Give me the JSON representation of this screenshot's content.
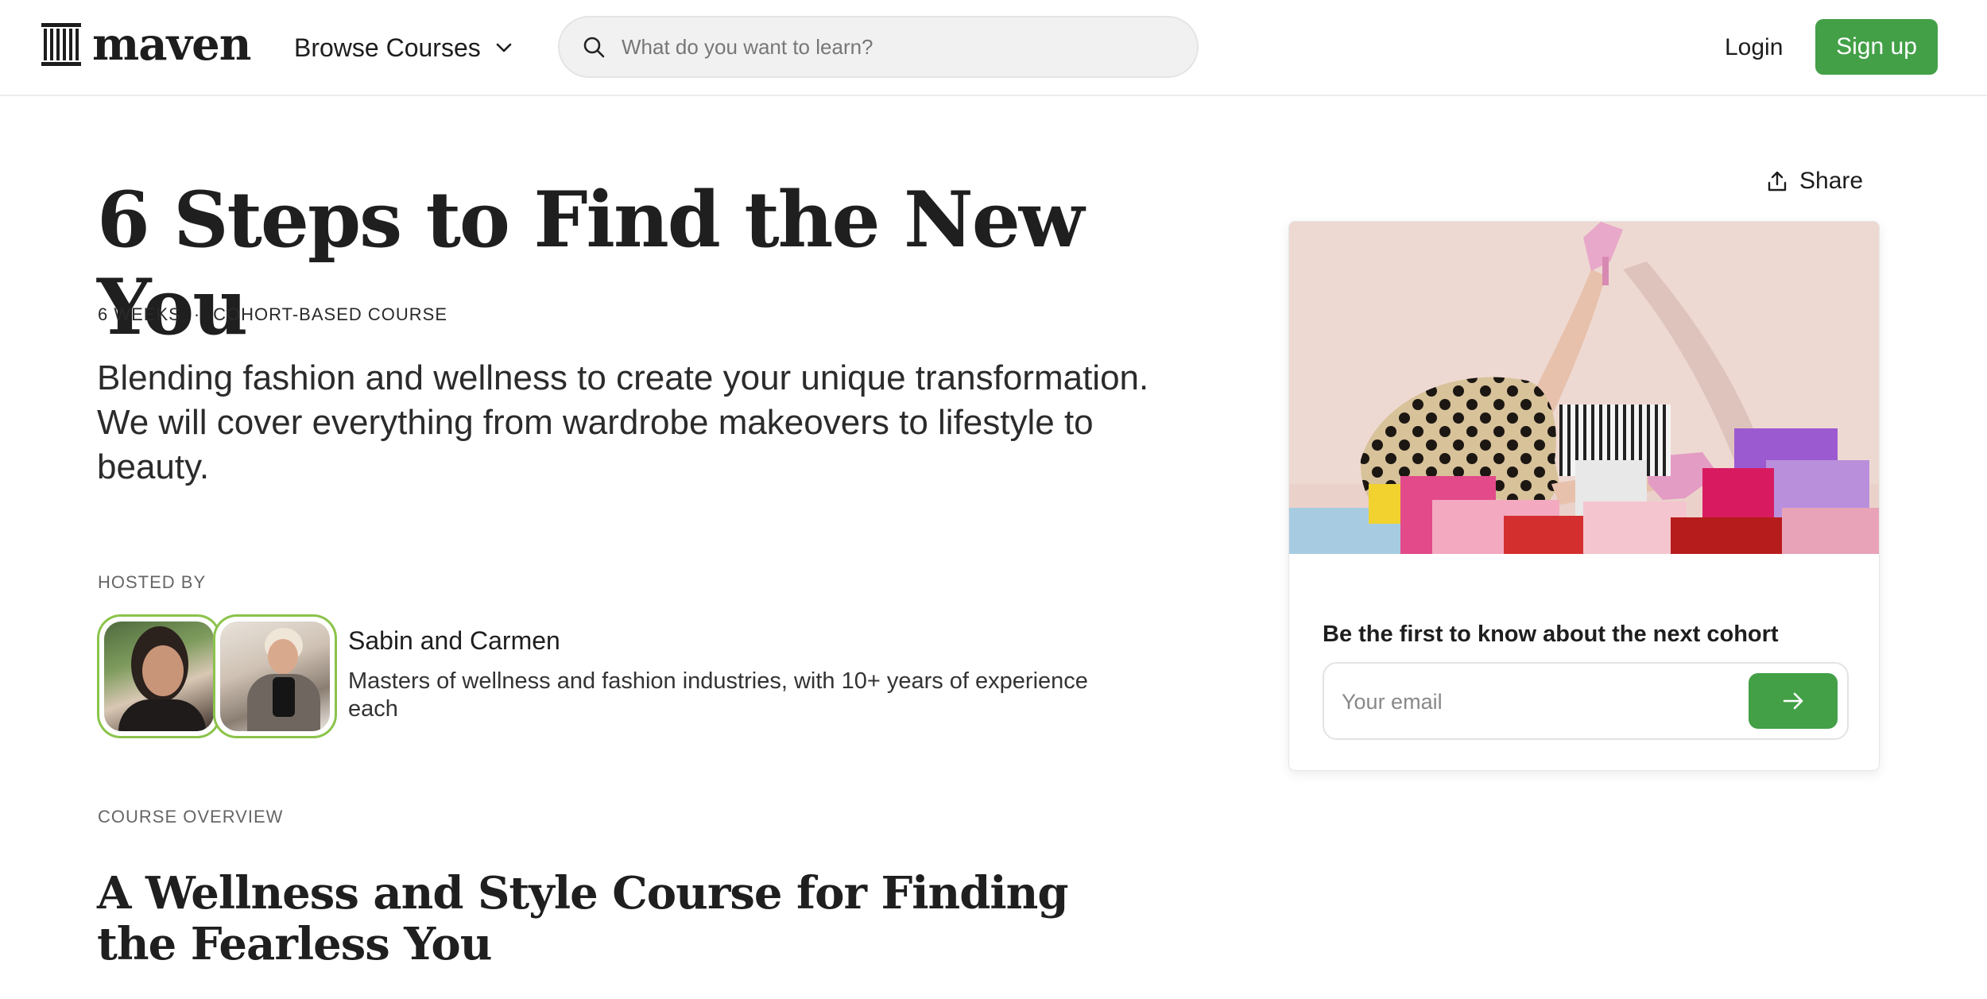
{
  "header": {
    "logo_text": "maven",
    "browse_label": "Browse Courses",
    "search_placeholder": "What do you want to learn?",
    "login_label": "Login",
    "signup_label": "Sign up"
  },
  "course": {
    "title": "6 Steps to Find the New You",
    "duration": "6 WEEKS",
    "separator": "·",
    "format": "COHORT-BASED COURSE",
    "tagline": "Blending fashion and wellness to create your unique transformation. We will cover everything from wardrobe makeovers to lifestyle to beauty."
  },
  "hosts": {
    "label": "HOSTED BY",
    "names": "Sabin and Carmen",
    "description": "Masters of wellness and fashion industries, with 10+ years of experience each"
  },
  "overview": {
    "label": "COURSE OVERVIEW",
    "title": "A Wellness and Style Course for Finding the Fearless You"
  },
  "card": {
    "share_label": "Share",
    "heading": "Be the first to know about the next cohort",
    "email_placeholder": "Your email"
  },
  "colors": {
    "brand_green": "#43a047",
    "avatar_border": "#8bc34a"
  },
  "icons": [
    "maven-logo-icon",
    "chevron-down-icon",
    "search-icon",
    "share-icon",
    "arrow-right-icon"
  ]
}
